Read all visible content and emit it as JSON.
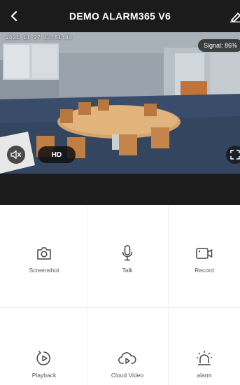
{
  "header": {
    "title": "DEMO ALARM365 V6",
    "back_icon": "chevron-left-icon",
    "edit_icon": "edit-pencil-icon"
  },
  "video": {
    "timestamp": "2021-11-27 14:51:30",
    "signal_text": "Signal: 86%",
    "quality_label": "HD",
    "mute_icon": "speaker-muted-icon",
    "fullscreen_icon": "fullscreen-icon"
  },
  "actions": [
    {
      "label": "Screenshot",
      "icon": "camera-icon"
    },
    {
      "label": "Talk",
      "icon": "microphone-icon"
    },
    {
      "label": "Record",
      "icon": "video-camera-icon"
    },
    {
      "label": "Playback",
      "icon": "playback-icon"
    },
    {
      "label": "Cloud Video",
      "icon": "cloud-play-icon"
    },
    {
      "label": "alarm",
      "icon": "alarm-siren-icon"
    }
  ],
  "colors": {
    "header_bg": "#1b1b1b",
    "dark_bar": "#1c1c1c",
    "icon_stroke": "#444444"
  }
}
